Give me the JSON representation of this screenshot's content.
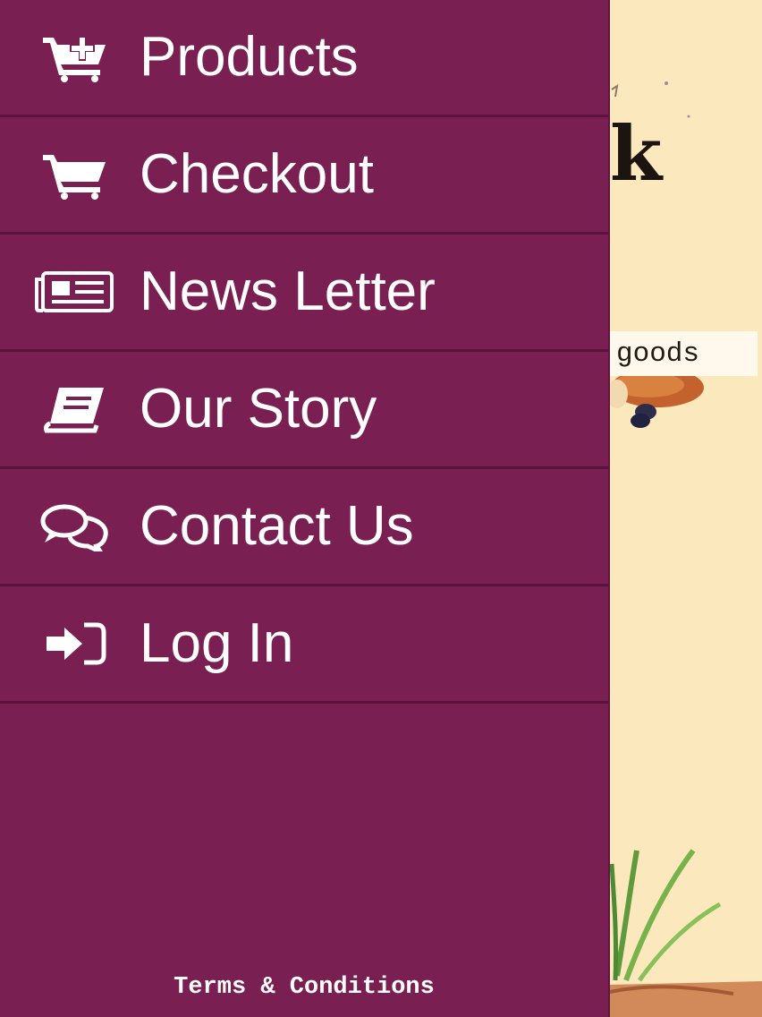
{
  "menu": {
    "items": [
      {
        "label": "Products",
        "icon": "cart-plus-icon"
      },
      {
        "label": "Checkout",
        "icon": "cart-icon"
      },
      {
        "label": "News Letter",
        "icon": "newspaper-icon"
      },
      {
        "label": "Our Story",
        "icon": "book-icon"
      },
      {
        "label": "Contact Us",
        "icon": "chat-bubbles-icon"
      },
      {
        "label": "Log In",
        "icon": "sign-in-icon"
      }
    ]
  },
  "footer": {
    "terms_label": "Terms & Conditions"
  },
  "background_page": {
    "logo_partial": "k",
    "tagline_partial": "goods"
  },
  "colors": {
    "drawer_background": "#7a1f52",
    "divider": "#58143b",
    "text": "#ffffff",
    "page_background": "#fce8bd"
  }
}
